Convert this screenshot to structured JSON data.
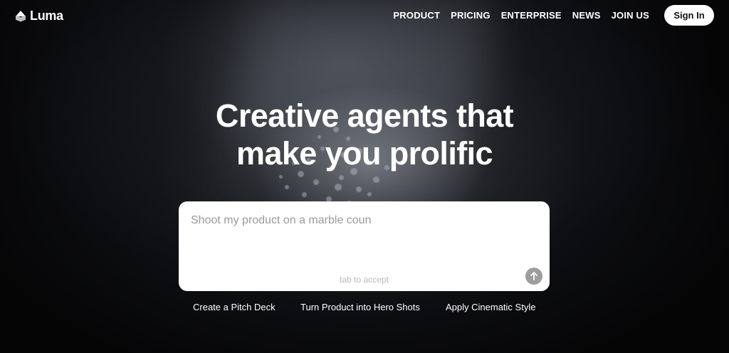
{
  "brand": {
    "name": "Luma",
    "icon": "luma-logo-icon"
  },
  "nav": {
    "items": [
      {
        "label": "PRODUCT"
      },
      {
        "label": "PRICING"
      },
      {
        "label": "ENTERPRISE"
      },
      {
        "label": "NEWS"
      },
      {
        "label": "JOIN US"
      }
    ],
    "sign_in_label": "Sign In"
  },
  "hero": {
    "headline_line1": "Creative agents that",
    "headline_line2": "make you prolific"
  },
  "prompt": {
    "placeholder": "Shoot my product on a marble coun",
    "hint": "tab to accept",
    "submit_icon": "arrow-up-icon"
  },
  "suggestions": [
    {
      "label": "Create a Pitch Deck"
    },
    {
      "label": "Turn Product into Hero Shots"
    },
    {
      "label": "Apply Cinematic Style"
    }
  ],
  "colors": {
    "background": "#000000",
    "text": "#ffffff",
    "button_bg": "#ffffff",
    "submit_bg": "#9d9d9d"
  }
}
